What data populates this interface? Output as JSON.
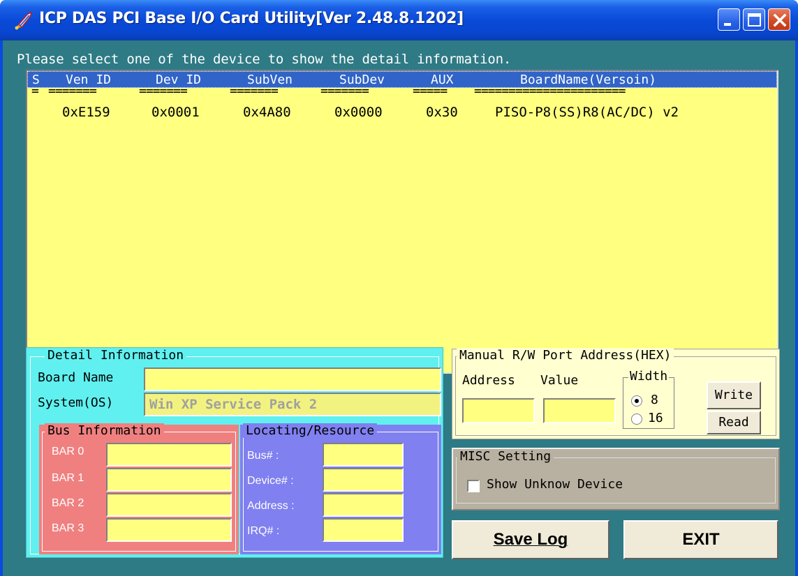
{
  "window": {
    "title": "ICP DAS PCI Base I/O Card Utility[Ver 2.48.8.1202]"
  },
  "prompt": "Please select one of the device to show the detail information.",
  "device_list": {
    "columns": [
      "S",
      "Ven ID",
      "Dev ID",
      "SubVen",
      "SubDev",
      "AUX",
      "BoardName(Versoin)"
    ],
    "separators": [
      "=",
      "=======",
      "=======",
      "=======",
      "=======",
      "=====",
      "======================"
    ],
    "rows": [
      {
        "s": "",
        "ven_id": "0xE159",
        "dev_id": "0x0001",
        "subven": "0x4A80",
        "subdev": "0x0000",
        "aux": "0x30",
        "board": "PISO-P8(SS)R8(AC/DC) v2"
      }
    ]
  },
  "detail": {
    "group_title": "Detail Information",
    "board_name_label": "Board Name",
    "board_name_value": "",
    "system_label": "System(OS)",
    "system_value": "Win XP Service Pack 2"
  },
  "bus": {
    "group_title": "Bus Information",
    "bars": [
      {
        "label": "BAR 0",
        "value": ""
      },
      {
        "label": "BAR 1",
        "value": ""
      },
      {
        "label": "BAR 2",
        "value": ""
      },
      {
        "label": "BAR 3",
        "value": ""
      }
    ]
  },
  "locating": {
    "group_title": "Locating/Resource",
    "items": [
      {
        "label": "Bus# :",
        "value": ""
      },
      {
        "label": "Device# :",
        "value": ""
      },
      {
        "label": "Address :",
        "value": ""
      },
      {
        "label": "IRQ# :",
        "value": ""
      }
    ]
  },
  "manual": {
    "group_title": "Manual R/W Port Address(HEX)",
    "address_label": "Address",
    "value_label": "Value",
    "address_value": "",
    "value_value": "",
    "width_title": "Width",
    "width_options": [
      "8",
      "16"
    ],
    "width_selected": "8",
    "write_label": "Write",
    "read_label": "Read"
  },
  "misc": {
    "group_title": "MISC Setting",
    "show_unknown_label": "Show Unknow Device",
    "show_unknown_checked": false
  },
  "buttons": {
    "save_log": "Save Log",
    "exit": "EXIT"
  },
  "colors": {
    "titlebar": "#0a4ae0",
    "client_bg": "#2e7a85",
    "list_bg": "#ffff80",
    "list_header": "#3064c8",
    "detail_bg": "#60f0f0",
    "bus_bg": "#f08080",
    "locating_bg": "#8080f0",
    "manual_bg": "#ffffd0",
    "misc_bg": "#b8b0a0",
    "button_bg": "#f0ead8"
  }
}
